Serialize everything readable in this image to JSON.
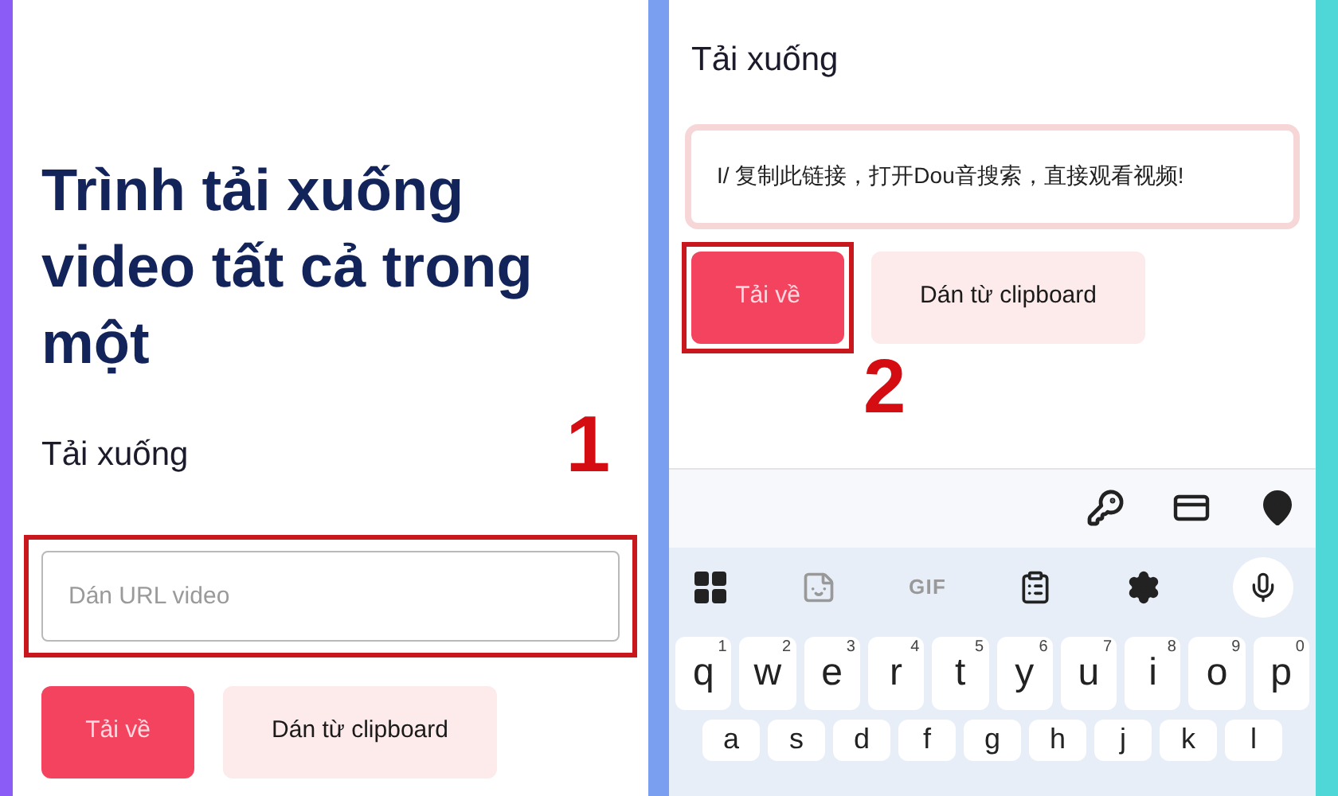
{
  "left_screen": {
    "heading": "Trình tải xuống video tất cả trong một",
    "section_label": "Tải xuống",
    "url_field": {
      "placeholder": "Dán URL video",
      "highlighted": true
    },
    "buttons": [
      {
        "label": "Tải về",
        "kind": "primary",
        "highlighted": false
      },
      {
        "label": "Dán từ clipboard",
        "kind": "secondary",
        "highlighted": false
      }
    ],
    "step_number": "1"
  },
  "right_screen": {
    "section_label": "Tải xuống",
    "url_field": {
      "value": "I/ 复制此链接，打开Dou音搜索，直接观看视频!",
      "highlighted": false
    },
    "buttons": [
      {
        "label": "Tải về",
        "kind": "primary",
        "highlighted": true
      },
      {
        "label": "Dán từ clipboard",
        "kind": "secondary",
        "highlighted": false
      }
    ],
    "step_number": "2",
    "keyboard": {
      "toolbar_gif": "GIF",
      "rows": [
        [
          {
            "letter": "q",
            "hint": "1"
          },
          {
            "letter": "w",
            "hint": "2"
          },
          {
            "letter": "e",
            "hint": "3"
          },
          {
            "letter": "r",
            "hint": "4"
          },
          {
            "letter": "t",
            "hint": "5"
          },
          {
            "letter": "y",
            "hint": "6"
          },
          {
            "letter": "u",
            "hint": "7"
          },
          {
            "letter": "i",
            "hint": "8"
          },
          {
            "letter": "o",
            "hint": "9"
          },
          {
            "letter": "p",
            "hint": "0"
          }
        ],
        [
          {
            "letter": "a"
          },
          {
            "letter": "s"
          },
          {
            "letter": "d"
          },
          {
            "letter": "f"
          },
          {
            "letter": "g"
          },
          {
            "letter": "h"
          },
          {
            "letter": "j"
          },
          {
            "letter": "k"
          },
          {
            "letter": "l"
          }
        ]
      ]
    }
  }
}
